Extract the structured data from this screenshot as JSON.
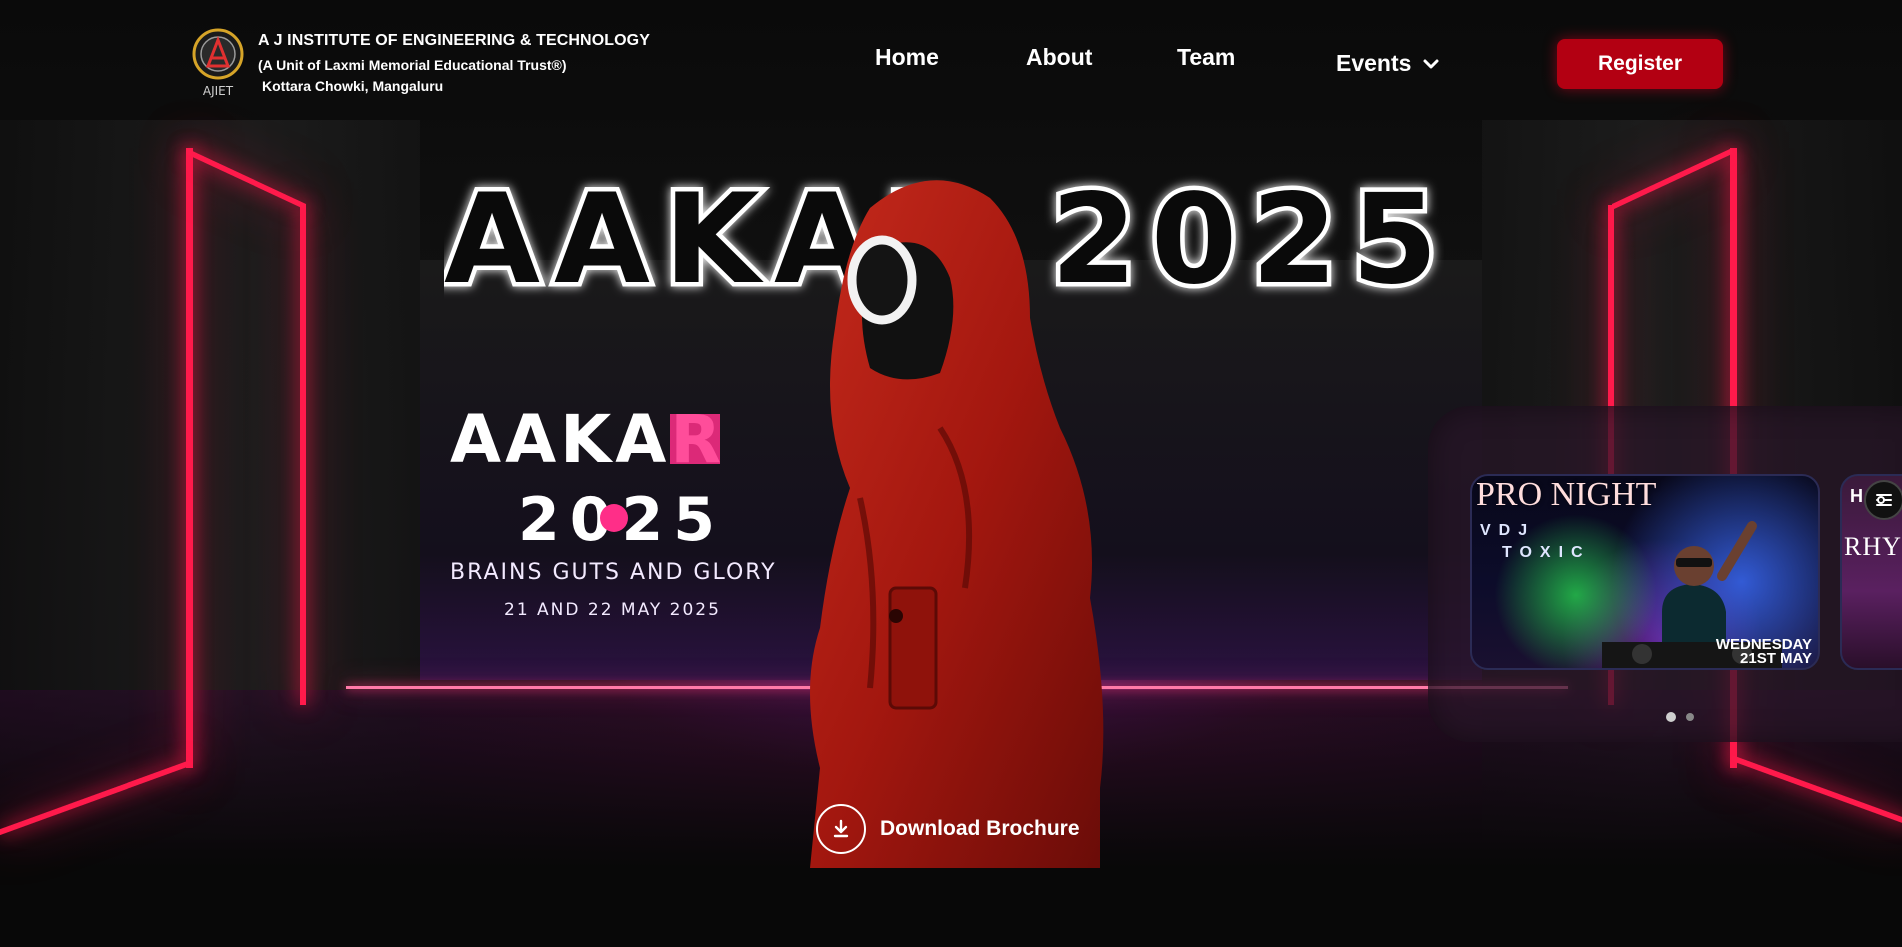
{
  "header": {
    "institute_name": "A J INSTITUTE OF ENGINEERING & TECHNOLOGY",
    "institute_unit": "(A Unit of Laxmi Memorial Educational Trust®)",
    "institute_address": "Kottara Chowki, Mangaluru",
    "logo_text": "AJIET",
    "nav": {
      "home": "Home",
      "about": "About",
      "team": "Team",
      "events": "Events"
    },
    "register_label": "Register"
  },
  "hero": {
    "big_title": "AAKAR 2025",
    "poster_title": "AAKAR",
    "poster_year": "2025",
    "tagline": "BRAINS GUTS AND GLORY",
    "dates": "21 AND 22 MAY 2025",
    "download_label": "Download Brochure"
  },
  "carousel": {
    "cards": [
      {
        "title": "PRO NIGHT",
        "sub1": "VDJ",
        "sub2": "TOXIC",
        "day": "WEDNESDAY",
        "date": "21ST MAY"
      },
      {
        "heading": "H",
        "title": "RHYTH"
      }
    ],
    "active_slide": 1,
    "slide_count": 2
  },
  "colors": {
    "neon_red": "#ff1a4b",
    "register_bg": "#b30012",
    "accent_pink": "#ff2e88"
  },
  "icons": {
    "chevron": "chevron-down-icon",
    "download": "download-icon",
    "filter": "filter-icon"
  }
}
